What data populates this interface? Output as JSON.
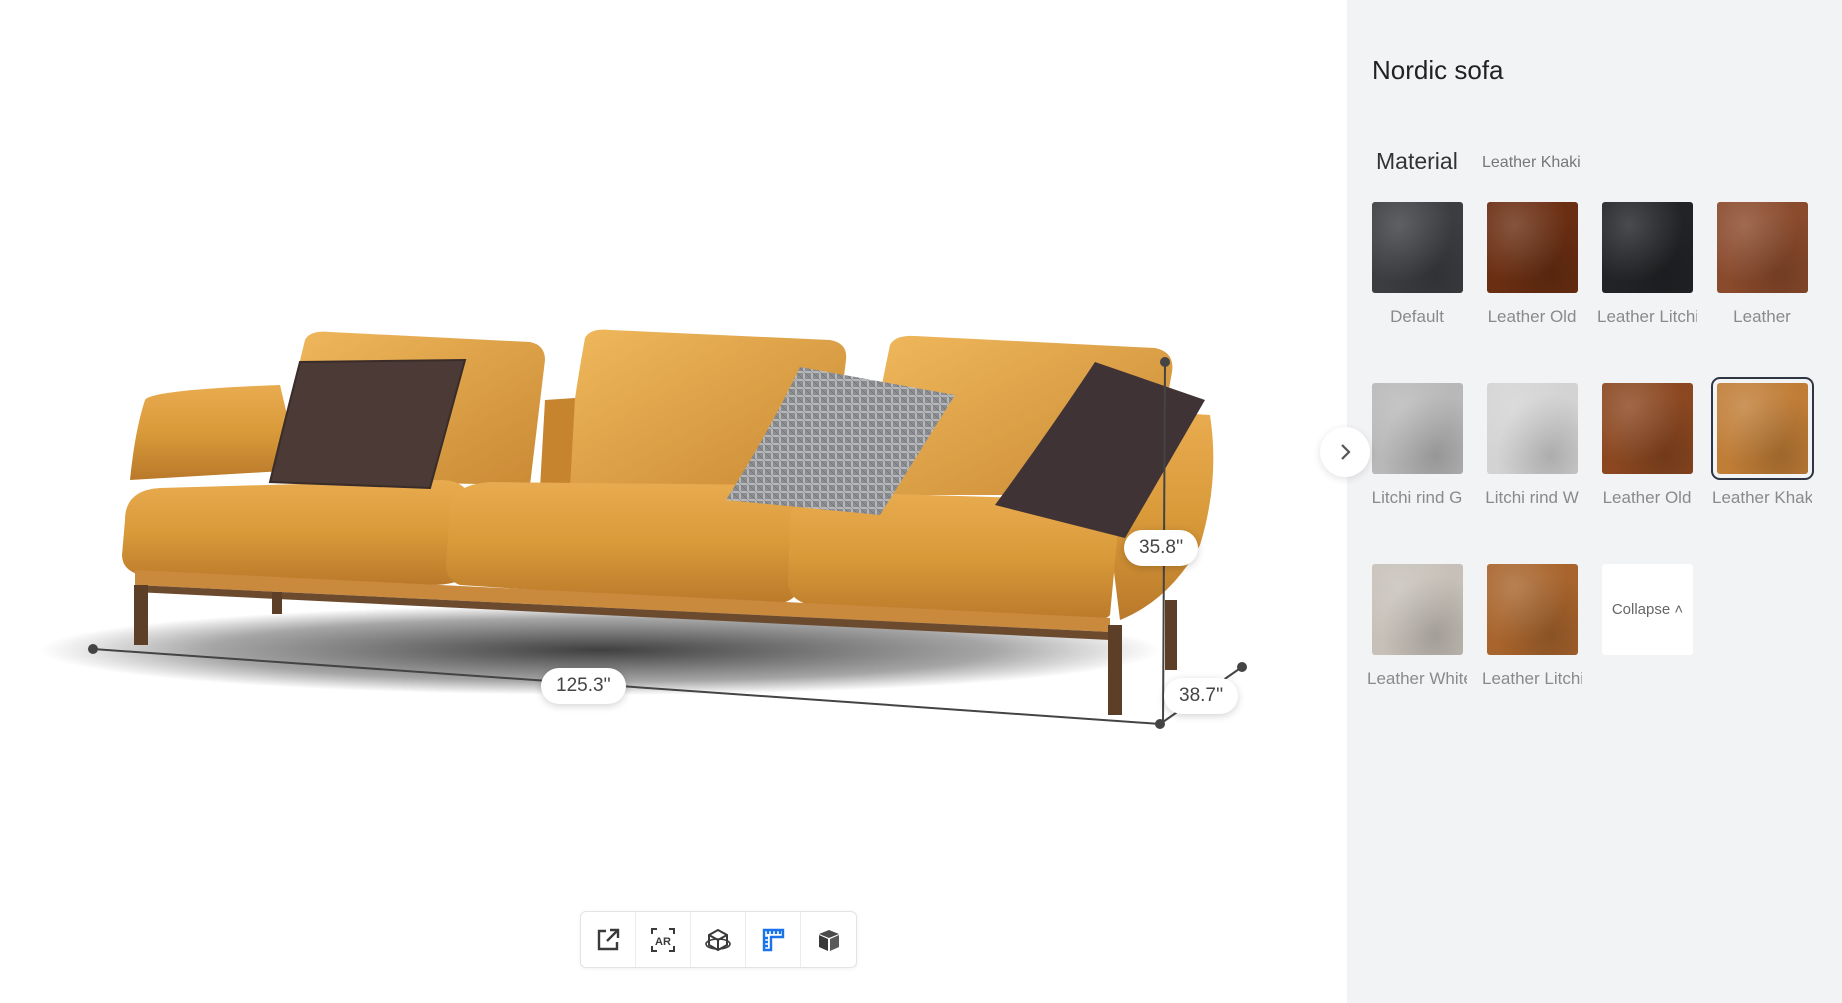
{
  "product": {
    "title": "Nordic sofa"
  },
  "material": {
    "label": "Material",
    "selected": "Leather Khaki",
    "swatches": [
      {
        "name": "Default",
        "color": "#3b3d41"
      },
      {
        "name": "Leather Old",
        "color": "#6a2e12"
      },
      {
        "name": "Leather Litchi",
        "color": "#222326"
      },
      {
        "name": "Leather",
        "color": "#8a4a2c"
      },
      {
        "name": "Litchi rind G",
        "color": "#b8b8b8"
      },
      {
        "name": "Litchi rind W",
        "color": "#d3d3d3"
      },
      {
        "name": "Leather Old",
        "color": "#8b4720"
      },
      {
        "name": "Leather Khaki",
        "color": "#c07d36"
      },
      {
        "name": "Leather White",
        "color": "#c6c0b8"
      },
      {
        "name": "Leather Litchi",
        "color": "#a8642c"
      }
    ],
    "collapse_label": "Collapse ˄"
  },
  "dimensions": {
    "width": "125.3''",
    "height": "35.8''",
    "depth": "38.7''"
  },
  "toolbar": {
    "tools": [
      {
        "name": "share-icon",
        "active": false
      },
      {
        "name": "ar-icon",
        "active": false
      },
      {
        "name": "3d-view-icon",
        "active": false
      },
      {
        "name": "measure-icon",
        "active": true
      },
      {
        "name": "box-icon",
        "active": false
      }
    ]
  },
  "colors": {
    "accent": "#1a73e8",
    "panel_bg": "#f2f3f5",
    "sofa_leather": "#d99a3a"
  }
}
